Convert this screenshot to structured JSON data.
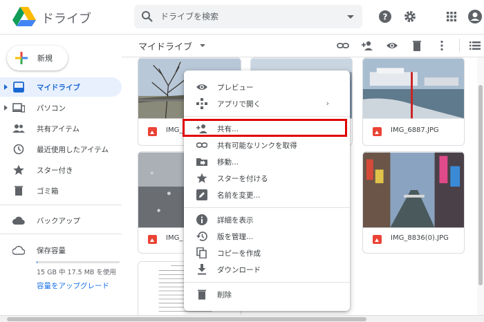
{
  "header": {
    "app_title": "ドライブ",
    "search_placeholder": "ドライブを検索",
    "icons": [
      "drive-logo",
      "search-icon",
      "search-options-caret",
      "help-icon",
      "settings-icon",
      "apps-icon",
      "account-icon"
    ]
  },
  "sidebar": {
    "new_label": "新規",
    "items": [
      {
        "label": "マイドライブ",
        "icon": "my-drive-icon",
        "active": true
      },
      {
        "label": "パソコン",
        "icon": "computers-icon"
      },
      {
        "label": "共有アイテム",
        "icon": "shared-icon"
      },
      {
        "label": "最近使用したアイテム",
        "icon": "recent-icon"
      },
      {
        "label": "スター付き",
        "icon": "star-icon"
      },
      {
        "label": "ゴミ箱",
        "icon": "trash-icon"
      }
    ],
    "backup_label": "バックアップ",
    "storage_label": "保存容量",
    "storage_text": "15 GB 中 17.5 MB を使用",
    "storage_fraction": 0.0012,
    "upgrade_label": "容量をアップグレード"
  },
  "toolbar": {
    "breadcrumb": "マイドライブ",
    "icons": [
      "link-icon",
      "add-person-icon",
      "preview-icon",
      "delete-icon",
      "more-icon",
      "list-view-icon"
    ]
  },
  "files": [
    {
      "name": "IMG_"
    },
    {
      "name": "IMG_6887.JPG"
    },
    {
      "name": "IMG_"
    },
    {
      "name": "IMG_8836(0).JPG"
    }
  ],
  "context_menu": {
    "items": [
      {
        "label": "プレビュー",
        "icon": "eye-icon"
      },
      {
        "label": "アプリで開く",
        "icon": "open-with-icon",
        "submenu": "›"
      },
      {
        "label": "共有...",
        "icon": "add-person-icon",
        "highlighted": true
      },
      {
        "label": "共有可能なリンクを取得",
        "icon": "link-icon"
      },
      {
        "label": "移動...",
        "icon": "move-icon"
      },
      {
        "label": "スターを付ける",
        "icon": "star-icon"
      },
      {
        "label": "名前を変更...",
        "icon": "rename-icon"
      },
      {
        "label": "詳細を表示",
        "icon": "info-icon"
      },
      {
        "label": "版を管理...",
        "icon": "history-icon"
      },
      {
        "label": "コピーを作成",
        "icon": "copy-icon"
      },
      {
        "label": "ダウンロード",
        "icon": "download-icon"
      },
      {
        "label": "削除",
        "icon": "trash-icon"
      }
    ]
  },
  "colors": {
    "accent": "#1a73e8",
    "active_bg": "#e8f0fe",
    "highlight_border": "#e00000"
  }
}
